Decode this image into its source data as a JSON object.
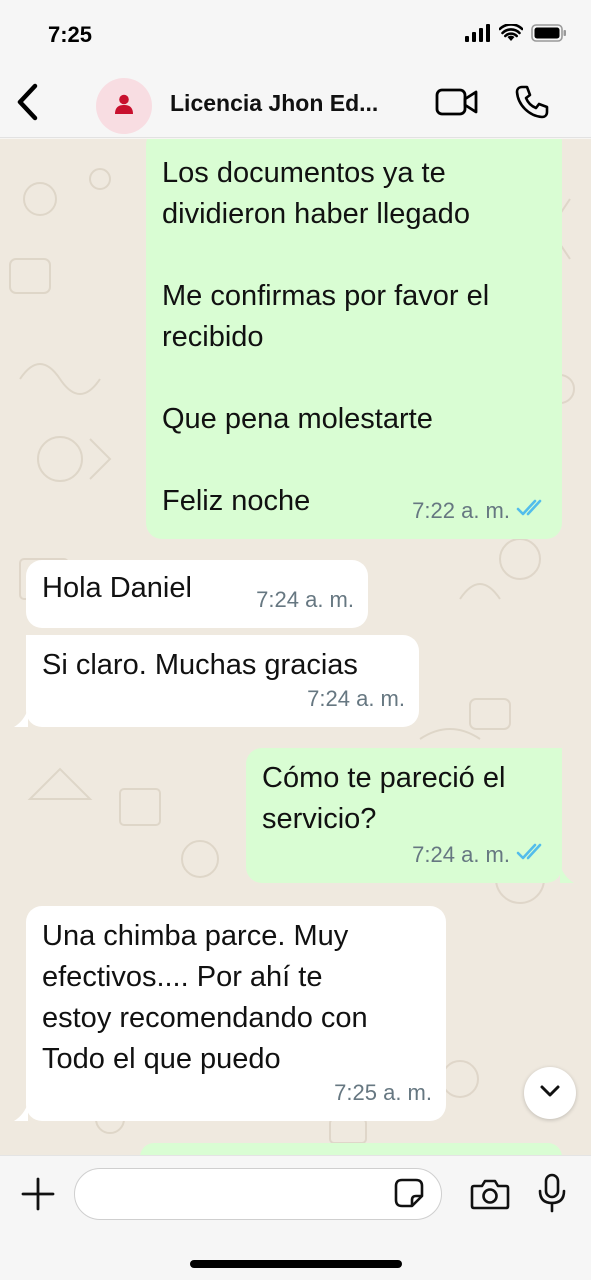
{
  "status_bar": {
    "time": "7:25",
    "icons": [
      "signal-icon",
      "wifi-icon",
      "battery-icon"
    ]
  },
  "header": {
    "contact_name": "Licencia Jhon Ed...",
    "icons": [
      "back-icon",
      "avatar-person-icon",
      "video-call-icon",
      "phone-call-icon"
    ]
  },
  "messages": [
    {
      "direction": "out",
      "text": "Los documentos ya te\ndividieron haber llegado\n\nMe confirmas por favor el\nrecibido\n\nQue pena molestarte\n\nFeliz noche",
      "time": "7:22 a. m.",
      "status": "read"
    },
    {
      "direction": "in",
      "text": "Hola Daniel",
      "time": "7:24 a. m."
    },
    {
      "direction": "in",
      "text": "Si claro. Muchas gracias",
      "time": "7:24 a. m."
    },
    {
      "direction": "out",
      "text": "Cómo te pareció el\nservicio?",
      "time": "7:24 a. m.",
      "status": "read"
    },
    {
      "direction": "in",
      "text": "Una chimba parce. Muy\nefectivos.... Por ahí te\nestoy recomendando con\nTodo el que puedo",
      "time": "7:25 a. m."
    }
  ],
  "composer": {
    "input_value": "",
    "icons": [
      "plus-icon",
      "sticker-icon",
      "camera-icon",
      "microphone-icon"
    ]
  },
  "colors": {
    "outgoing_bubble": "#d9fdd3",
    "incoming_bubble": "#ffffff",
    "read_ticks": "#53bdeb",
    "avatar_bg": "#f8dde2",
    "avatar_icon": "#c8102e",
    "chat_background": "#efe9df"
  }
}
